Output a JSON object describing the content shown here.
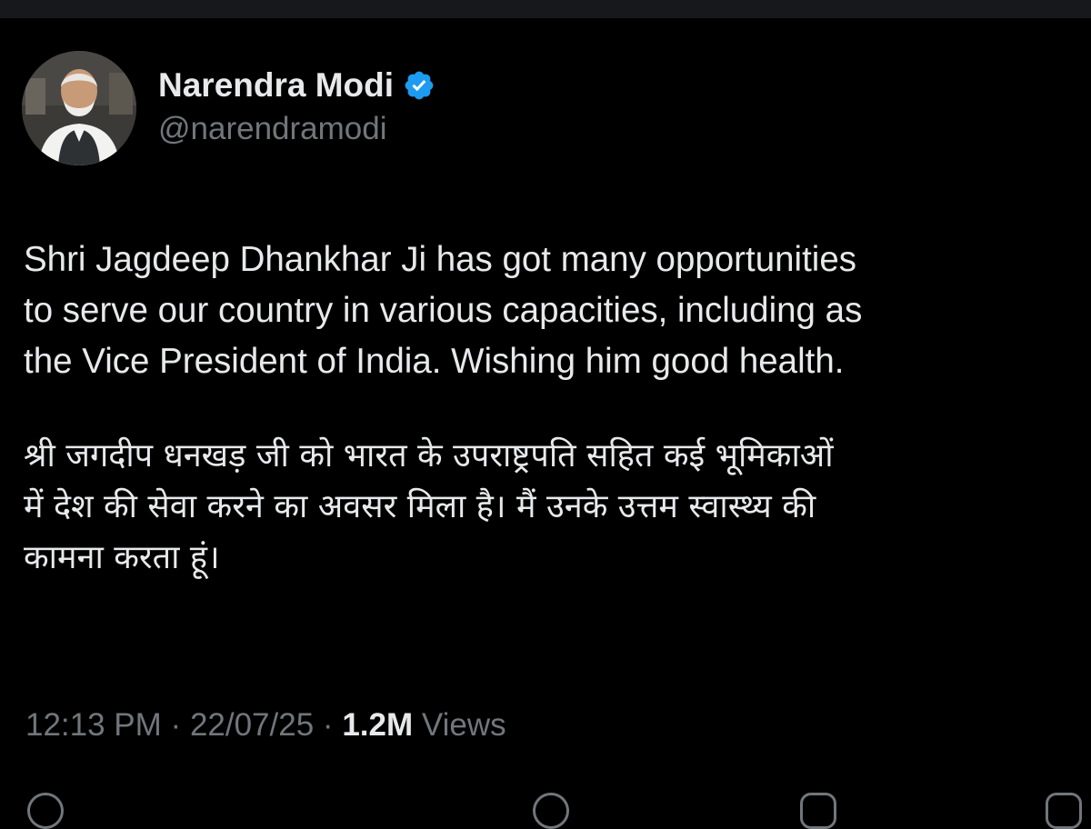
{
  "tweet": {
    "author": {
      "display_name": "Narendra Modi",
      "handle": "@narendramodi",
      "verified": true,
      "avatar_icon": "profile-photo"
    },
    "text_en": [
      "Shri Jagdeep Dhankhar Ji has got many opportunities",
      "to serve our country in various capacities, including as",
      "the Vice President of India. Wishing him good health."
    ],
    "text_hi": [
      "श्री जगदीप धनखड़ जी को भारत के उपराष्ट्रपति सहित कई भूमिकाओं",
      "में देश की सेवा करने का अवसर मिला है। मैं उनके उत्तम स्वास्थ्य की",
      "कामना करता हूं।"
    ],
    "time": "12:13 PM",
    "separator": "·",
    "date": "22/07/25",
    "views_count": "1.2M",
    "views_label": "Views"
  },
  "actions": [
    "reply-icon",
    "repost-icon",
    "like-icon",
    "bookmark-icon",
    "share-icon"
  ],
  "colors": {
    "background": "#000000",
    "text_primary": "#e7e9ea",
    "text_secondary": "#71767b",
    "verified_blue": "#1d9bf0"
  }
}
